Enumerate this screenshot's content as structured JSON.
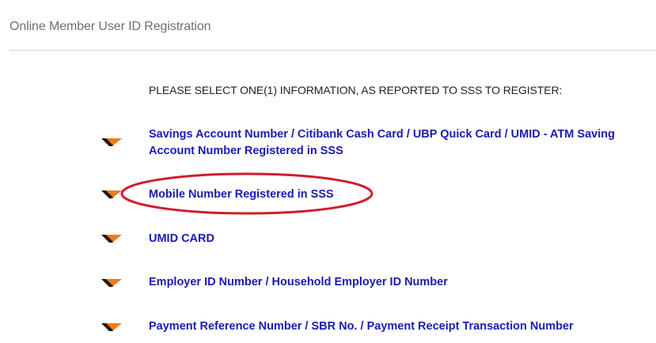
{
  "page": {
    "title": "Online Member User ID Registration"
  },
  "instruction": "PLEASE SELECT ONE(1) INFORMATION, AS REPORTED TO SSS TO REGISTER:",
  "options": [
    {
      "label_line1": "Savings Account Number / Citibank Cash Card / UBP Quick Card / UMID - ATM Saving",
      "label_line2": "Account Number Registered in SSS",
      "icon": "orange-arrow-bullet-icon"
    },
    {
      "label": "Mobile Number Registered in SSS",
      "icon": "orange-arrow-bullet-icon",
      "highlighted": true
    },
    {
      "label": "UMID CARD",
      "icon": "orange-arrow-bullet-icon"
    },
    {
      "label": "Employer ID Number / Household Employer ID Number",
      "icon": "orange-arrow-bullet-icon"
    },
    {
      "label": "Payment Reference Number / SBR No. / Payment Receipt Transaction Number",
      "icon": "orange-arrow-bullet-icon"
    }
  ],
  "colors": {
    "link": "#1a1ab4",
    "bullet_orange": "#f07a1a",
    "bullet_dark": "#1c1c1c",
    "highlight_ring": "#d01c2c"
  }
}
